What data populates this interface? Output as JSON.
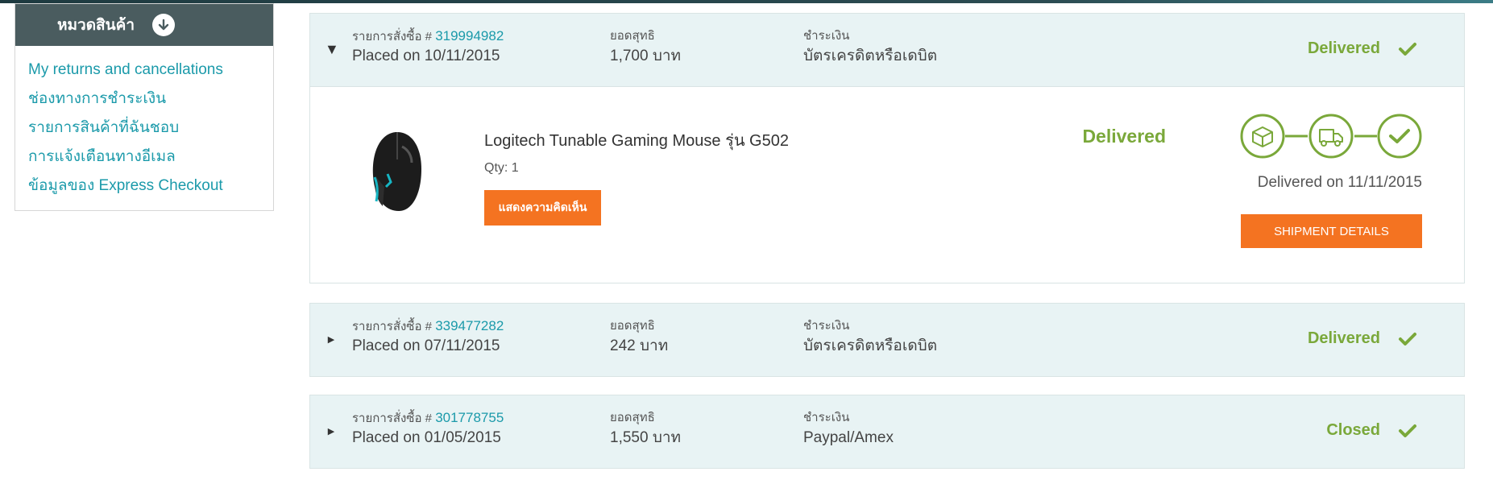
{
  "sidebar": {
    "title": "หมวดสินค้า",
    "links": [
      {
        "label": "My returns and cancellations"
      },
      {
        "label": "ช่องทางการชำระเงิน"
      },
      {
        "label": "รายการสินค้าที่ฉันชอบ"
      },
      {
        "label": "การแจ้งเตือนทางอีเมล"
      },
      {
        "label": "ข้อมูลของ Express Checkout"
      }
    ]
  },
  "labels": {
    "order_prefix": "รายการสั่งซื้อ # ",
    "total": "ยอดสุทธิ",
    "payment": "ชำระเงิน"
  },
  "orders": [
    {
      "number": "319994982",
      "placed": "Placed on 10/11/2015",
      "total": "1,700 บาท",
      "payment": "บัตรเครดิตหรือเดบิต",
      "status": "Delivered",
      "expanded": true,
      "item": {
        "name": "Logitech Tunable Gaming Mouse รุ่น G502",
        "qty": "Qty: 1",
        "review_button": "แสดงความคิดเห็น",
        "status": "Delivered",
        "delivered_on": "Delivered on 11/11/2015",
        "shipment_button": "SHIPMENT DETAILS"
      }
    },
    {
      "number": "339477282",
      "placed": "Placed on 07/11/2015",
      "total": "242 บาท",
      "payment": "บัตรเครดิตหรือเดบิต",
      "status": "Delivered",
      "expanded": false
    },
    {
      "number": "301778755",
      "placed": "Placed on 01/05/2015",
      "total": "1,550 บาท",
      "payment": "Paypal/Amex",
      "status": "Closed",
      "expanded": false
    }
  ],
  "colors": {
    "accent": "#1b9aaa",
    "status_green": "#7aa83a",
    "button_orange": "#f47321",
    "header_bg": "#e8f3f4",
    "sidebar_header": "#4a5c5f"
  },
  "icons": {
    "collapse": "triangle-down-icon",
    "expand": "triangle-right-icon",
    "status": "checkmark-icon",
    "tracker": [
      "package-icon",
      "truck-icon",
      "checkmark-icon"
    ],
    "category": "arrow-down-circle-icon"
  }
}
